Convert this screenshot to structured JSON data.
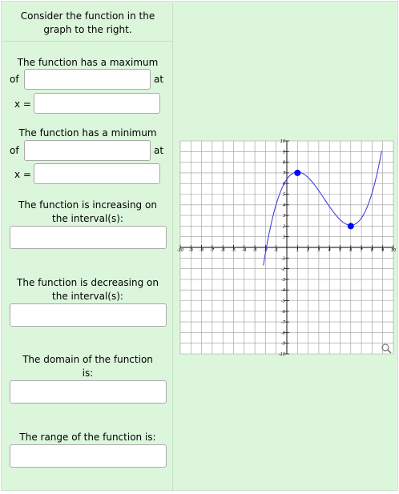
{
  "prompt": {
    "line1": "Consider the function in the",
    "line2": "graph to the right."
  },
  "max": {
    "line1": "The function has a maximum",
    "of": "of",
    "at": "at",
    "x_eq": "x =",
    "value": "",
    "x_value": ""
  },
  "min": {
    "line1": "The function has a minimum",
    "of": "of",
    "at": "at",
    "x_eq": "x =",
    "value": "",
    "x_value": ""
  },
  "increasing": {
    "line1": "The function is increasing on",
    "line2": "the interval(s):",
    "value": ""
  },
  "decreasing": {
    "line1": "The function is decreasing on",
    "line2": "the interval(s):",
    "value": ""
  },
  "domain": {
    "line1": "The domain of the function",
    "line2": "is:",
    "value": ""
  },
  "range": {
    "line1": "The range of the function is:",
    "value": ""
  },
  "graph": {
    "xlim": [
      -10,
      10
    ],
    "ylim": [
      -10,
      10
    ],
    "x_ticks": [
      "-10",
      "-9",
      "-8",
      "-7",
      "-6",
      "-5",
      "-4",
      "-3",
      "-2",
      "-1",
      "1",
      "2",
      "3",
      "4",
      "5",
      "6",
      "7",
      "8",
      "9",
      "10"
    ],
    "y_ticks": [
      "10",
      "9",
      "8",
      "7",
      "6",
      "5",
      "4",
      "3",
      "2",
      "1",
      "-1",
      "-2",
      "-3",
      "-4",
      "-5",
      "-6",
      "-7",
      "-8",
      "-9",
      "-10"
    ],
    "curve_color": "#3333dd",
    "point_color": "#0000ff",
    "key_points": [
      {
        "x": 1,
        "y": 7
      },
      {
        "x": 6,
        "y": 2
      }
    ],
    "zoom_icon": "magnifier-icon"
  }
}
